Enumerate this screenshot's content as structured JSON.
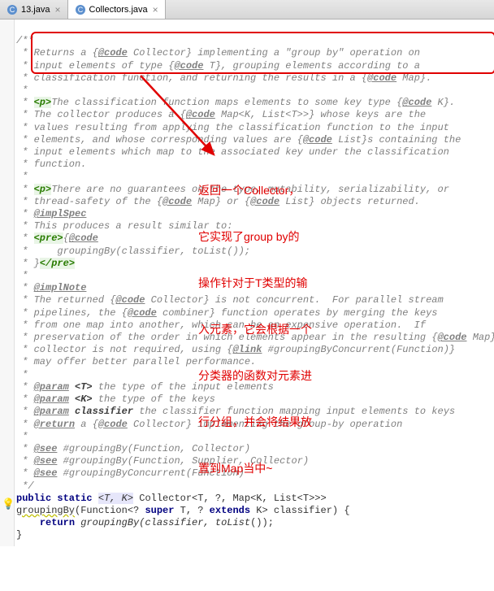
{
  "tabs": {
    "t0": {
      "label": "13.java"
    },
    "t1": {
      "label": "Collectors.java"
    }
  },
  "doc": {
    "open": "/**",
    "p1l1": " * Returns a {",
    "p1l1b": "@code",
    "p1l1c": " Collector} implementing a \"group by\" operation on",
    "p1l2": " * input elements of type {",
    "p1l2b": "@code",
    "p1l2c": " T}, grouping elements according to a",
    "p1l3": " * classification function, and returning the results in a {",
    "p1l3b": "@code",
    "p1l3c": " Map}.",
    "star": " *",
    "p2l1a": " * ",
    "p2l1tag": "<p>",
    "p2l1b": "The classification function maps elements to some key type {",
    "p2l1c": "@code",
    "p2l1d": " K}.",
    "p2l2a": " * The collector produces a {",
    "p2l2b": "@code",
    "p2l2c": " Map<K, List<T>>} whose keys are the",
    "p2l3": " * values resulting from applying the classification function to the input",
    "p2l4a": " * elements, and whose corresponding values are {",
    "p2l4b": "@code",
    "p2l4c": " List}s containing the",
    "p2l5": " * input elements which map to the associated key under the classification",
    "p2l6": " * function.",
    "p3l1a": " * ",
    "p3l1tag": "<p>",
    "p3l1b": "There are no guarantees on the type, mutability, serializability, or",
    "p3l2a": " * thread-safety of the {",
    "p3l2b": "@code",
    "p3l2c": " Map} or {",
    "p3l2d": "@code",
    "p3l2e": " List} objects returned.",
    "implspec": " * ",
    "implspecTag": "@implSpec",
    "p4l1": " * This produces a result similar to:",
    "pre1a": " * ",
    "pre1tag": "<pre>",
    "pre1b": "{",
    "pre1c": "@code",
    "pre2": " *     groupingBy(classifier, toList());",
    "pre3a": " * }",
    "pre3tag": "</pre>",
    "implnote": " * ",
    "implnoteTag": "@implNote",
    "in1a": " * The returned {",
    "in1b": "@code",
    "in1c": " Collector} is not concurrent.  For parallel stream",
    "in2a": " * pipelines, the {",
    "in2b": "@code",
    "in2c": " combiner} function operates by merging the keys",
    "in3": " * from one map into another, which can be an expensive operation.  If",
    "in4a": " * preservation of the order in which elements appear in the resulting {",
    "in4b": "@code",
    "in4c": " Map}",
    "in5a": " * collector is not required, using {",
    "in5b": "@link",
    "in5c": " #groupingByConcurrent(",
    "in5d": "Function",
    "in5e": ")}",
    "in6": " * may offer better parallel performance.",
    "pa1a": " * ",
    "pa1b": "@param",
    "pa1c": " ",
    "pa1d": "<T>",
    "pa1e": " the type of the input elements",
    "pa2a": " * ",
    "pa2b": "@param",
    "pa2c": " ",
    "pa2d": "<K>",
    "pa2e": " the type of the keys",
    "pa3a": " * ",
    "pa3b": "@param",
    "pa3c": " ",
    "pa3d": "classifier",
    "pa3e": " the classifier function mapping input elements to keys",
    "reta": " * ",
    "retb": "@return",
    "retc": " a {",
    "retd": "@code",
    "rete": " Collector} implementing the group-by operation",
    "see1a": " * ",
    "see1b": "@see",
    "see1c": " #groupingBy(",
    "see1d": "Function",
    "see1e": ", ",
    "see1f": "Collector",
    "see1g": ")",
    "see2a": " * ",
    "see2b": "@see",
    "see2c": " #groupingBy(",
    "see2d": "Function",
    "see2e": ", ",
    "see2f": "Supplier",
    "see2g": ", ",
    "see2h": "Collector",
    "see2i": ")",
    "see3a": " * ",
    "see3b": "@see",
    "see3c": " #groupingByConcurrent(",
    "see3d": "Function",
    "see3e": ")",
    "close": " */"
  },
  "code": {
    "l1a": "public static ",
    "l1b": "<T, K>",
    "l1c": " Collector<T, ?, Map<K, List<T>>>",
    "l2a": "groupingBy",
    "l2b": "(Function<? ",
    "l2c": "super",
    "l2d": " T, ? ",
    "l2e": "extends",
    "l2f": " K> classifier) {",
    "l3a": "    ",
    "l3b": "return",
    "l3c": " ",
    "l3d": "groupingBy(classifier, ",
    "l3e": "toList",
    "l3f": "());",
    "l4": "}"
  },
  "annotation": {
    "l1": "返回一个Collector，",
    "l2": "它实现了group by的",
    "l3": "操作针对于T类型的输",
    "l4": "入元素，它会根据一个",
    "l5": "分类器的函数对元素进",
    "l6": "行分组，并会将结果放",
    "l7": "置到Map当中~"
  }
}
